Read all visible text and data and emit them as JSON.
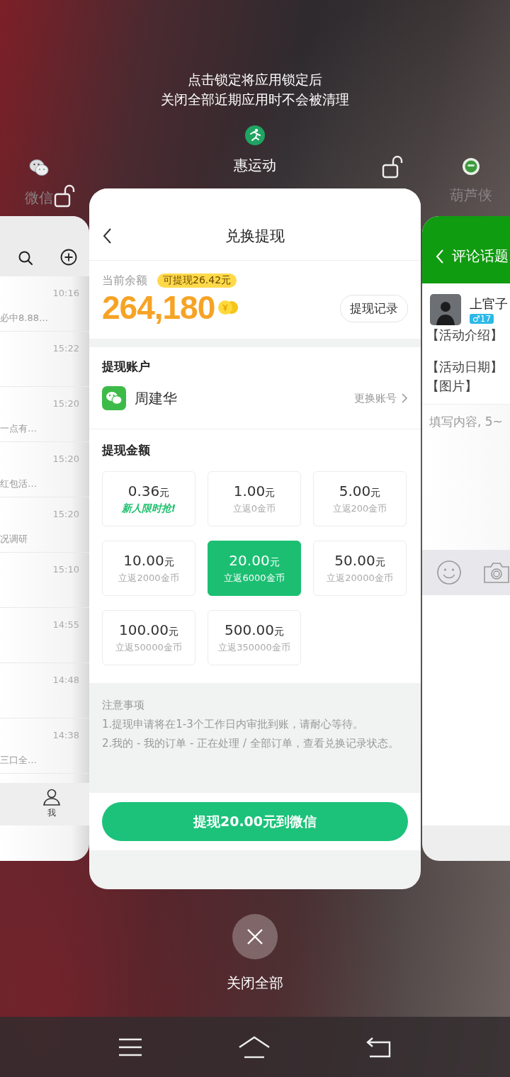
{
  "hint": [
    "点击锁定将应用锁定后",
    "关闭全部近期应用时不会被清理"
  ],
  "apps": [
    {
      "name": "微信",
      "selected": false,
      "locked": false
    },
    {
      "name": "惠运动",
      "selected": true,
      "locked": false
    },
    {
      "name": "葫芦侠",
      "selected": false
    }
  ],
  "left_card": {
    "rows": [
      {
        "time": "10:16",
        "preview": "必中8.88…"
      },
      {
        "time": "15:22"
      },
      {
        "time": "15:20",
        "preview": "一点有…"
      },
      {
        "time": "15:20",
        "preview": "红包活…"
      },
      {
        "time": "15:20",
        "preview": "况调研"
      },
      {
        "time": "15:10"
      },
      {
        "time": "14:55"
      },
      {
        "time": "14:48"
      },
      {
        "time": "14:38",
        "preview": "三口全…"
      }
    ],
    "tab_label": "我"
  },
  "main_card": {
    "title": "兑换提现",
    "balance_label": "当前余额",
    "withdrawable_badge": "可提现26.42元",
    "balance": "264,180",
    "history_button": "提现记录",
    "account_heading": "提现账户",
    "account_name": "周建华",
    "change_account": "更换账号",
    "amount_heading": "提现金额",
    "amounts": [
      {
        "value": "0.36",
        "unit": "元",
        "note": "新人限时抢!",
        "kind": "promo",
        "selected": false
      },
      {
        "value": "1.00",
        "unit": "元",
        "note": "立返0金币",
        "kind": "plain",
        "selected": false
      },
      {
        "value": "5.00",
        "unit": "元",
        "note": "立返200金币",
        "kind": "plain",
        "selected": false
      },
      {
        "value": "10.00",
        "unit": "元",
        "note": "立返2000金币",
        "kind": "plain",
        "selected": false
      },
      {
        "value": "20.00",
        "unit": "元",
        "note": "立返6000金币",
        "kind": "plain",
        "selected": true
      },
      {
        "value": "50.00",
        "unit": "元",
        "note": "立返20000金币",
        "kind": "plain",
        "selected": false
      },
      {
        "value": "100.00",
        "unit": "元",
        "note": "立返50000金币",
        "kind": "plain",
        "selected": false
      },
      {
        "value": "500.00",
        "unit": "元",
        "note": "立返350000金币",
        "kind": "plain",
        "selected": false
      }
    ],
    "notes_title": "注意事项",
    "notes": [
      "1.提现申请将在1-3个工作日内审批到账，请耐心等待。",
      "2.我的 - 我的订单 - 正在处理 / 全部订单，查看兑换记录状态。"
    ],
    "submit": "提现20.00元到微信"
  },
  "right_card": {
    "title": "评论话题",
    "user_name": "上官子",
    "badge": "♂17",
    "lines": [
      "【活动介绍】",
      "【活动日期】",
      "【图片】"
    ],
    "placeholder": "填写内容, 5~"
  },
  "close_all": "关闭全部"
}
